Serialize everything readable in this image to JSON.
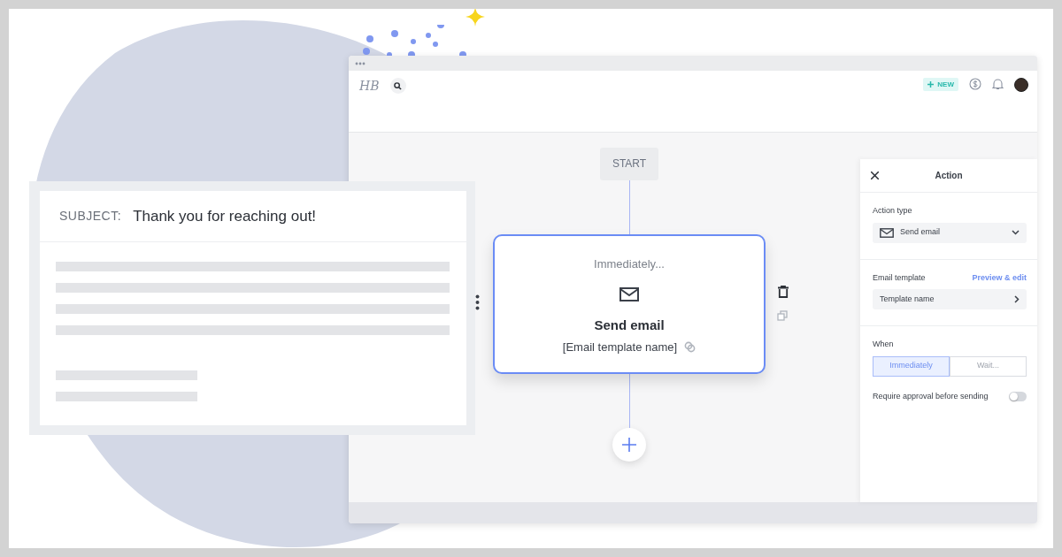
{
  "email_preview": {
    "subject_label": "SUBJECT:",
    "subject": "Thank you for reaching out!"
  },
  "window": {
    "logo": "HB",
    "new_button": "NEW"
  },
  "workflow": {
    "start": "START",
    "step": {
      "timing": "Immediately...",
      "action": "Send email",
      "template": "[Email template name]"
    }
  },
  "action_panel": {
    "title": "Action",
    "action_type_label": "Action type",
    "action_type": "Send email",
    "email_template_label": "Email template",
    "preview_link": "Preview & edit",
    "template_value": "Template name",
    "when_label": "When",
    "when_options": [
      {
        "label": "Immediately",
        "selected": true
      },
      {
        "label": "Wait...",
        "selected": false
      }
    ],
    "approval_label": "Require approval before sending",
    "approval_on": false
  }
}
